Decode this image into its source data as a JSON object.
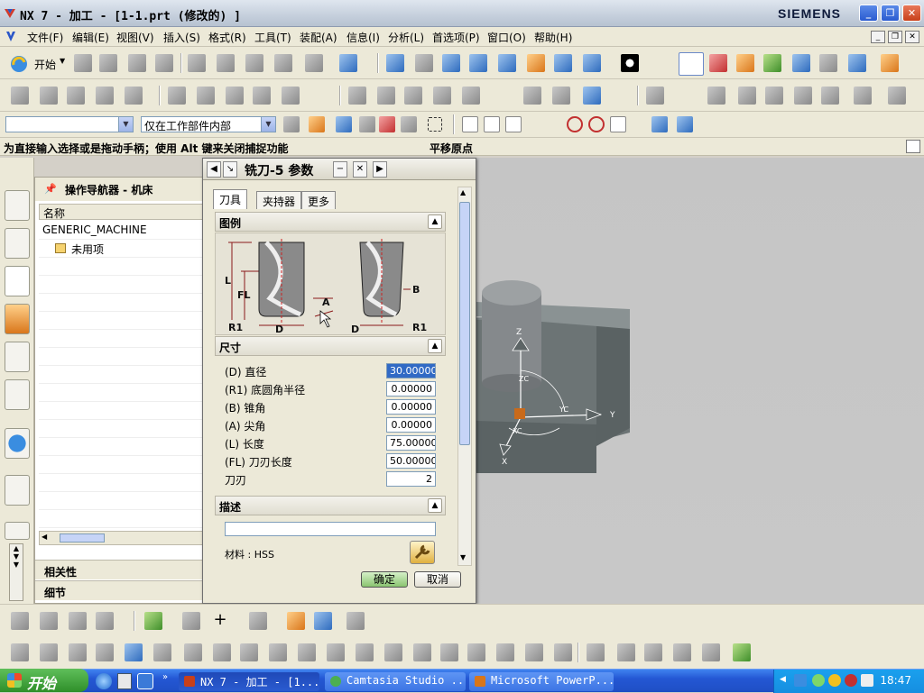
{
  "window": {
    "title": "NX 7 - 加工 - [1-1.prt  (修改的) ]",
    "brand": "SIEMENS",
    "controls": {
      "minimize": "_",
      "maximize": "❐",
      "close": "✕"
    }
  },
  "menu": {
    "items": [
      "文件(F)",
      "编辑(E)",
      "视图(V)",
      "插入(S)",
      "格式(R)",
      "工具(T)",
      "装配(A)",
      "信息(I)",
      "分析(L)",
      "首选项(P)",
      "窗口(O)",
      "帮助(H)"
    ]
  },
  "toolbar": {
    "start_label": "开始",
    "selection_filter": "",
    "scope_filter": "仅在工作部件内部"
  },
  "cue": {
    "prompt": "为直接输入选择或是拖动手柄；使用 Alt 键来关闭捕捉功能",
    "status": "平移原点"
  },
  "navigator": {
    "title": "操作导航器 - 机床",
    "column_header": "名称",
    "rows": [
      "GENERIC_MACHINE",
      "未用项"
    ],
    "sections": [
      "相关性",
      "细节"
    ]
  },
  "dialog": {
    "title": "铣刀-5 参数",
    "tabs": [
      "刀具",
      "夹持器",
      "更多"
    ],
    "groups": {
      "legend": "图例",
      "dimensions": "尺寸",
      "description": "描述"
    },
    "legend_labels": {
      "L": "L",
      "FL": "FL",
      "R1": "R1",
      "D": "D",
      "A": "A",
      "B": "B"
    },
    "params": [
      {
        "label": "(D) 直径",
        "value": "30.00000"
      },
      {
        "label": "(R1) 底圆角半径",
        "value": "0.00000"
      },
      {
        "label": "(B) 锥角",
        "value": "0.00000"
      },
      {
        "label": "(A) 尖角",
        "value": "0.00000"
      },
      {
        "label": "(L) 长度",
        "value": "75.00000"
      },
      {
        "label": "(FL) 刀刃长度",
        "value": "50.00000"
      },
      {
        "label": "刀刃",
        "value": "2"
      }
    ],
    "description_value": "",
    "material_label": "材料 : HSS",
    "ok_label": "确定",
    "cancel_label": "取消"
  },
  "viewport": {
    "axis_labels": [
      "Z",
      "ZC",
      "YC",
      "Y",
      "XC",
      "X"
    ]
  },
  "taskbar": {
    "start_label": "开始",
    "tasks": [
      "NX 7 - 加工 - [1...",
      "Camtasia Studio ...",
      "Microsoft PowerP..."
    ],
    "clock": "18:47"
  }
}
